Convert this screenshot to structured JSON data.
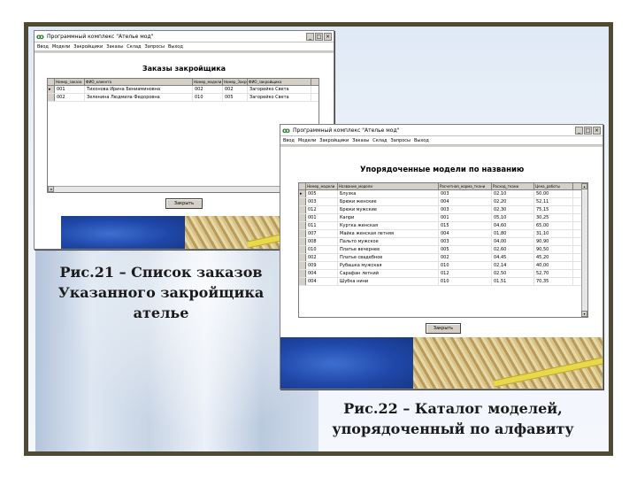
{
  "slide": {
    "caption_left": [
      "Рис.21 – Список заказов",
      "Указанного закройщика",
      "ателье"
    ],
    "caption_right": [
      "Рис.22 – Каталог моделей,",
      "упорядоченный по алфавиту"
    ]
  },
  "window1": {
    "title": "Программный комплекс \"Ателье мод\"",
    "menu": [
      "Ввод",
      "Модели",
      "Закройщики",
      "Заказы",
      "Склад",
      "Запросы",
      "Выход"
    ],
    "heading": "Заказы закройщика",
    "columns": [
      "Номер_заказа",
      "ФИО_клиента",
      "Номер_модели",
      "Номер_Закройщика",
      "ФИО_закройщика"
    ],
    "rows": [
      [
        "001",
        "Тихонова Ирина Бениаминовна",
        "002",
        "002",
        "Загорейко Света"
      ],
      [
        "002",
        "Зеленина Людмила Федоровна",
        "010",
        "005",
        "Загорейко Света"
      ]
    ],
    "button_label": "Закрыть"
  },
  "window2": {
    "title": "Программный комплекс \"Ателье мод\"",
    "menu": [
      "Ввод",
      "Модели",
      "Закройщики",
      "Заказы",
      "Склад",
      "Запросы",
      "Выход"
    ],
    "heading": "Упорядоченные модели по названию",
    "columns": [
      "Номер_модели",
      "Название_модели",
      "Расчетная_норма_ткани",
      "Расход_ткани",
      "Цена_работы"
    ],
    "rows": [
      [
        "005",
        "Блузка",
        "003",
        "02,10",
        "50,00"
      ],
      [
        "003",
        "Брюки женские",
        "004",
        "02,20",
        "52,11"
      ],
      [
        "012",
        "Брюки мужские",
        "003",
        "02,30",
        "75,15"
      ],
      [
        "001",
        "Капри",
        "001",
        "05,10",
        "30,25"
      ],
      [
        "011",
        "Куртка женская",
        "015",
        "04,60",
        "65,00"
      ],
      [
        "007",
        "Майка женская летняя",
        "004",
        "01,80",
        "31,10"
      ],
      [
        "008",
        "Пальто мужское",
        "003",
        "04,00",
        "90,90"
      ],
      [
        "010",
        "Платье вечернее",
        "005",
        "02,60",
        "90,50"
      ],
      [
        "002",
        "Платье свадебное",
        "002",
        "04,45",
        "45,20"
      ],
      [
        "009",
        "Рубашка мужская",
        "010",
        "02,14",
        "40,00"
      ],
      [
        "004",
        "Сарафан летний",
        "012",
        "02,50",
        "52,70"
      ],
      [
        "004",
        "Шубка нини",
        "010",
        "01,51",
        "70,35"
      ]
    ],
    "button_label": "Закрыть"
  }
}
